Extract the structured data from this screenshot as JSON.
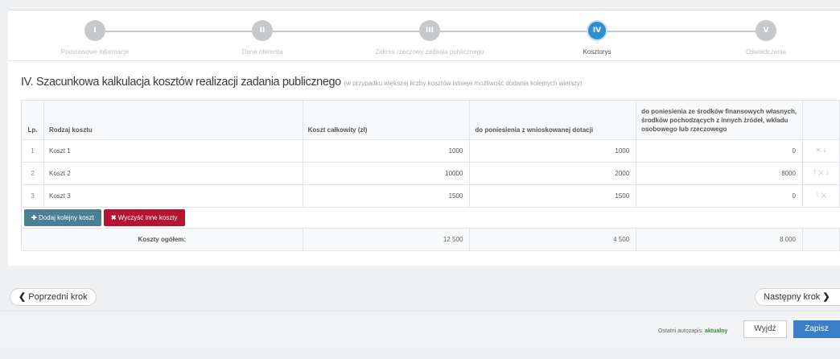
{
  "steps": [
    {
      "numeral": "I",
      "label": "Podstawowe informacje"
    },
    {
      "numeral": "II",
      "label": "Dane oferenta"
    },
    {
      "numeral": "III",
      "label": "Zakres rzeczowy zadania publicznego"
    },
    {
      "numeral": "IV",
      "label": "Kosztorys"
    },
    {
      "numeral": "V",
      "label": "Oświadczenia"
    }
  ],
  "active_step": 3,
  "heading": {
    "title": "IV. Szacunkowa kalkulacja kosztów realizacji zadania publicznego",
    "hint": "(w przypadku większej liczby kosztów istnieje możliwość dodania kolejnych wierszy)"
  },
  "table": {
    "headers": {
      "lp": "Lp.",
      "type": "Rodzaj kosztu",
      "total": "Koszt całkowity (zł)",
      "grant": "do poniesienia z wnioskowanej dotacji",
      "own": "do poniesienia ze środków finansowych własnych, środków pochodzących z innych źródeł, wkładu osobowego lub rzeczowego"
    },
    "rows": [
      {
        "lp": "1",
        "type": "Koszt 1",
        "total": "1000",
        "grant": "1000",
        "own": "0"
      },
      {
        "lp": "2",
        "type": "Koszt 2",
        "total": "10000",
        "grant": "2000",
        "own": "8000"
      },
      {
        "lp": "3",
        "type": "Koszt 3",
        "total": "1500",
        "grant": "1500",
        "own": "0"
      }
    ],
    "add_button": "Dodaj kolejny koszt",
    "clear_button": "Wyczyść inne koszty",
    "totals": {
      "label": "Koszty ogółem:",
      "total": "12 500",
      "grant": "4 500",
      "own": "8 000"
    }
  },
  "nav": {
    "prev": "Poprzedni krok",
    "next": "Następny krok"
  },
  "footer": {
    "autosave_label": "Ostatni autozapis:",
    "autosave_status": "aktualny",
    "exit": "Wyjdź",
    "save": "Zapisz"
  },
  "colors": {
    "accent": "#2d8fd0",
    "add": "#4d7e94",
    "clear": "#b31432",
    "save": "#3a80c7",
    "ok": "#3a8a3a"
  }
}
